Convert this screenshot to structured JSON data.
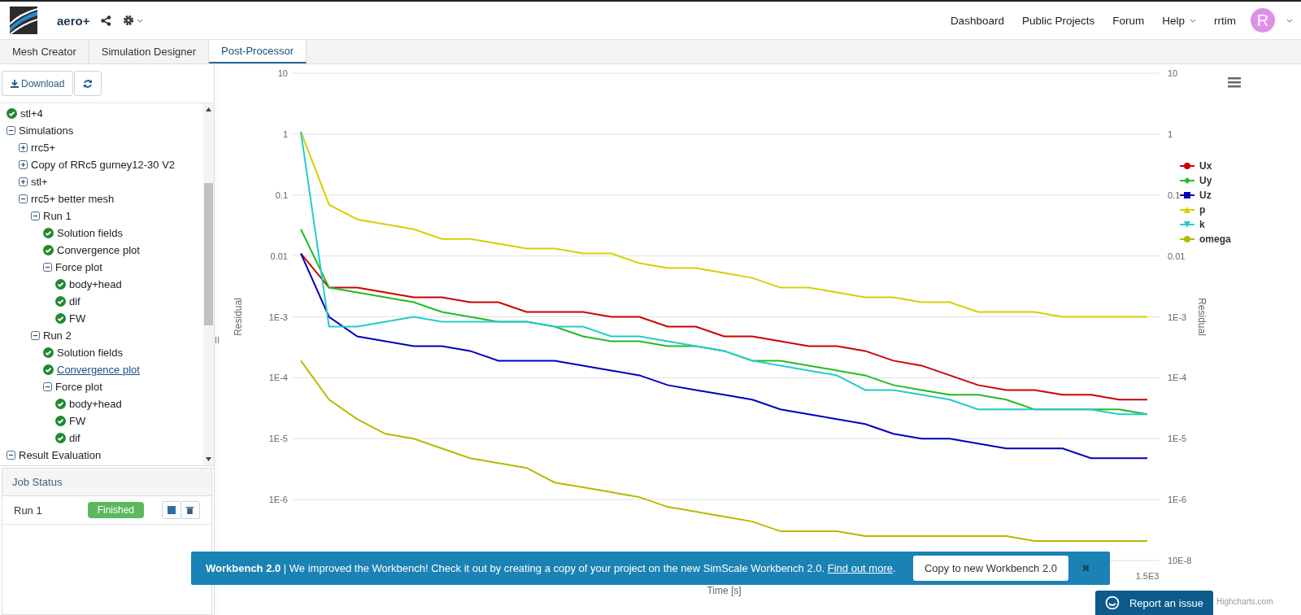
{
  "header": {
    "brand": "aero+",
    "nav": [
      {
        "label": "Dashboard",
        "dropdown": false
      },
      {
        "label": "Public Projects",
        "dropdown": false
      },
      {
        "label": "Forum",
        "dropdown": false
      },
      {
        "label": "Help",
        "dropdown": true
      }
    ],
    "user": {
      "name": "rrtim",
      "initial": "R"
    }
  },
  "tabs": [
    {
      "label": "Mesh Creator",
      "selected": false
    },
    {
      "label": "Simulation Designer",
      "selected": false
    },
    {
      "label": "Post-Processor",
      "selected": true
    }
  ],
  "toolbar": {
    "download": "Download"
  },
  "tree": [
    {
      "kind": "done",
      "label": "stl+4",
      "selected": false
    },
    {
      "kind": "group",
      "label": "Simulations",
      "expanded": true,
      "selected": false,
      "children": [
        {
          "kind": "group",
          "label": "rrc5+",
          "expanded": false,
          "selected": false
        },
        {
          "kind": "group",
          "label": "Copy of RRc5 gurney12-30 V2",
          "expanded": false,
          "selected": false
        },
        {
          "kind": "group",
          "label": "stl+",
          "expanded": false,
          "selected": false
        },
        {
          "kind": "group",
          "label": "rrc5+ better mesh",
          "expanded": true,
          "selected": false,
          "children": [
            {
              "kind": "group",
              "label": "Run 1",
              "expanded": true,
              "selected": false,
              "children": [
                {
                  "kind": "done",
                  "label": "Solution fields",
                  "selected": false
                },
                {
                  "kind": "done",
                  "label": "Convergence plot",
                  "selected": false
                },
                {
                  "kind": "group",
                  "label": "Force plot",
                  "expanded": true,
                  "selected": false,
                  "children": [
                    {
                      "kind": "done",
                      "label": "body+head",
                      "selected": false
                    },
                    {
                      "kind": "done",
                      "label": "dif",
                      "selected": false
                    },
                    {
                      "kind": "done",
                      "label": "FW",
                      "selected": false
                    }
                  ]
                }
              ]
            },
            {
              "kind": "group",
              "label": "Run 2",
              "expanded": true,
              "selected": false,
              "children": [
                {
                  "kind": "done",
                  "label": "Solution fields",
                  "selected": false
                },
                {
                  "kind": "done",
                  "label": "Convergence plot",
                  "selected": true
                },
                {
                  "kind": "group",
                  "label": "Force plot",
                  "expanded": true,
                  "selected": false,
                  "children": [
                    {
                      "kind": "done",
                      "label": "body+head",
                      "selected": false
                    },
                    {
                      "kind": "done",
                      "label": "FW",
                      "selected": false
                    },
                    {
                      "kind": "done",
                      "label": "dif",
                      "selected": false
                    }
                  ]
                }
              ]
            }
          ]
        }
      ]
    },
    {
      "kind": "group",
      "label": "Result Evaluation",
      "expanded": true,
      "selected": false
    }
  ],
  "job_status": {
    "title": "Job Status",
    "jobs": [
      {
        "name": "Run 1",
        "status": "Finished"
      }
    ]
  },
  "chart": {
    "left_axis_labels": [
      "10",
      "1",
      "0.1",
      "0.01",
      "1E-3",
      "1E-4",
      "1E-5",
      "1E-6"
    ],
    "right_axis_labels": [
      "10",
      "1",
      "0.1",
      "0.01",
      "1E-3",
      "1E-4",
      "1E-5",
      "1E-6",
      "10E-8"
    ],
    "left_axis_title": "Residual",
    "right_axis_title": "Residual",
    "x_axis_labels": [
      "1.5E3"
    ],
    "x_axis_title": "Time [s]",
    "legend": [
      {
        "name": "Ux",
        "color": "#cc0000"
      },
      {
        "name": "Uy",
        "color": "#22bb22"
      },
      {
        "name": "Uz",
        "color": "#0000bb"
      },
      {
        "name": "p",
        "color": "#d2d200"
      },
      {
        "name": "k",
        "color": "#22cccc"
      },
      {
        "name": "omega",
        "color": "#b8b800"
      }
    ],
    "credit": "Highcharts.com"
  },
  "banner": {
    "text": "**Workbench 2.0** | We improved the Workbench! Check it out by creating a copy of your project on the new SimScale Workbench 2.0.",
    "link": "Find out more",
    "after": ".",
    "button": "Copy to new Workbench 2.0",
    "close": "✖"
  },
  "report_button": "Report an issue"
}
